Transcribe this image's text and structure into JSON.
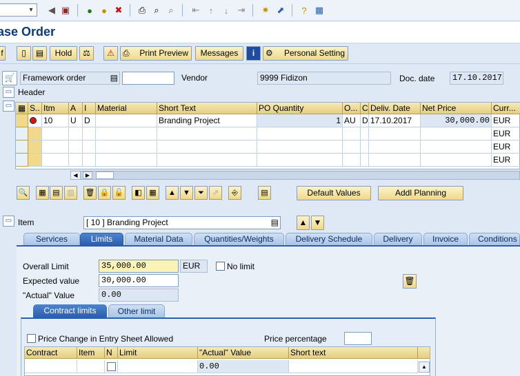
{
  "title": "ase Order",
  "toolbar": {
    "icons": [
      "back-icon",
      "exit-icon",
      "cancel-icon",
      "print-icon",
      "find-icon",
      "find-next-icon",
      "first-page-icon",
      "prev-page-icon",
      "next-page-icon",
      "last-page-icon",
      "new-session-icon",
      "shortcut-icon",
      "help-icon",
      "customize-icon"
    ]
  },
  "apptb": {
    "hold": "Hold",
    "print_preview": "Print Preview",
    "messages": "Messages",
    "personal_setting": "Personal Setting",
    "partial_label": "f"
  },
  "header_row": {
    "order_type": "Framework order",
    "vendor_label": "Vendor",
    "vendor_value": "9999 Fidizon",
    "doc_date_label": "Doc. date",
    "doc_date_value": "17.10.2017",
    "header_label": "Header"
  },
  "grid": {
    "columns": [
      "S..",
      "Itm",
      "A",
      "I",
      "Material",
      "Short Text",
      "PO Quantity",
      "O...",
      "C",
      "Deliv. Date",
      "Net Price",
      "Curr..."
    ],
    "rows": [
      {
        "itm": "10",
        "a": "U",
        "i": "D",
        "material": "",
        "short_text": "Branding Project",
        "qty": "1",
        "o": "AU",
        "c": "D",
        "date": "17.10.2017",
        "price": "30,000.00",
        "curr": "EUR"
      },
      {
        "itm": "",
        "a": "",
        "i": "",
        "material": "",
        "short_text": "",
        "qty": "",
        "o": "",
        "c": "",
        "date": "",
        "price": "",
        "curr": "EUR"
      },
      {
        "itm": "",
        "a": "",
        "i": "",
        "material": "",
        "short_text": "",
        "qty": "",
        "o": "",
        "c": "",
        "date": "",
        "price": "",
        "curr": "EUR"
      },
      {
        "itm": "",
        "a": "",
        "i": "",
        "material": "",
        "short_text": "",
        "qty": "",
        "o": "",
        "c": "",
        "date": "",
        "price": "",
        "curr": "EUR"
      }
    ]
  },
  "actions": {
    "default_values": "Default Values",
    "addl_planning": "Addl Planning"
  },
  "item": {
    "label": "Item",
    "value": "[ 10 ] Branding Project"
  },
  "tabs": [
    "Services",
    "Limits",
    "Material Data",
    "Quantities/Weights",
    "Delivery Schedule",
    "Delivery",
    "Invoice",
    "Conditions"
  ],
  "active_tab": "Limits",
  "limits": {
    "overall_label": "Overall Limit",
    "overall_value": "35,000.00",
    "currency": "EUR",
    "no_limit": "No limit",
    "expected_label": "Expected value",
    "expected_value": "30,000.00",
    "actual_label": "\"Actual\" Value",
    "actual_value": "0.00"
  },
  "subtabs": [
    "Contract limits",
    "Other limit"
  ],
  "contract": {
    "price_change": "Price Change in Entry Sheet Allowed",
    "price_percentage": "Price percentage",
    "columns": [
      "Contract",
      "Item",
      "N",
      "Limit",
      "\"Actual\" Value",
      "Short text"
    ],
    "row_actual": "0.00"
  },
  "colors": {
    "accent": "#2a5fad",
    "button": "#efd989",
    "background": "#dfe9f5"
  }
}
